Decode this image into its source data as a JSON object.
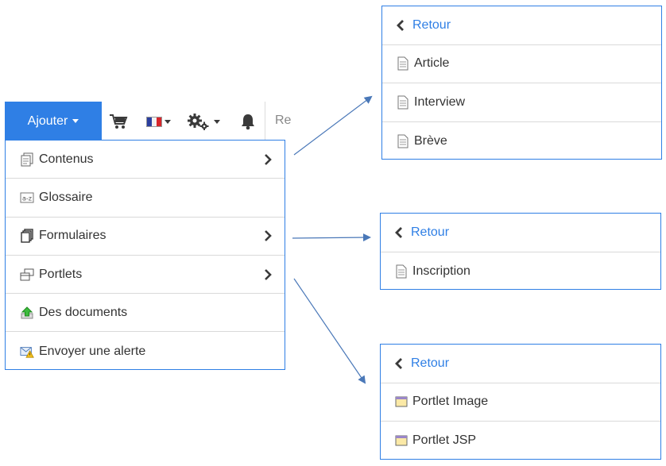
{
  "toolbar": {
    "add_label": "Ajouter",
    "search_partial": "Re",
    "icons": [
      "cart-icon",
      "flag-fr-icon",
      "gears-icon",
      "bell-icon"
    ]
  },
  "menu": {
    "items": [
      {
        "label": "Contenus",
        "icon": "documents-icon",
        "has_submenu": true
      },
      {
        "label": "Glossaire",
        "icon": "glossary-icon",
        "has_submenu": false
      },
      {
        "label": "Formulaires",
        "icon": "forms-icon",
        "has_submenu": true
      },
      {
        "label": "Portlets",
        "icon": "portlets-icon",
        "has_submenu": true
      },
      {
        "label": "Des documents",
        "icon": "upload-icon",
        "has_submenu": false
      },
      {
        "label": "Envoyer une alerte",
        "icon": "alert-mail-icon",
        "has_submenu": false
      }
    ]
  },
  "submenus": {
    "contenus": {
      "back": "Retour",
      "items": [
        "Article",
        "Interview",
        "Brève"
      ]
    },
    "formulaires": {
      "back": "Retour",
      "items": [
        "Inscription"
      ]
    },
    "portlets": {
      "back": "Retour",
      "items": [
        "Portlet Image",
        "Portlet JSP"
      ]
    }
  },
  "colors": {
    "accent": "#2f7fe5",
    "border": "#d9d9d9",
    "text": "#333333"
  }
}
